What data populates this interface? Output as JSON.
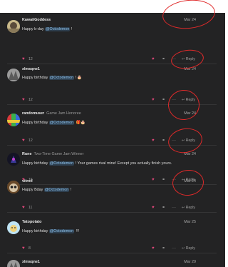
{
  "posts": [
    {
      "username": "KawaiiGoddess",
      "user_title": "",
      "date": "Mar 24",
      "text_before": "Happy b-day ",
      "mention": "@Octodemon",
      "text_after": " !",
      "emoji": "",
      "likes": "12",
      "reply_label": "Reply"
    },
    {
      "username": "xlmsqne1",
      "user_title": "",
      "date": "Mar 24",
      "text_before": "Happy birthday ",
      "mention": "@Octodemon",
      "text_after": " !",
      "emoji": "🎂",
      "likes": "12",
      "reply_label": "Reply"
    },
    {
      "username": "randomuser",
      "user_title": "Game Jam Honoree",
      "date": "Mar 24",
      "text_before": "Happy birthday ",
      "mention": "@Octodemon",
      "text_after": " ",
      "emoji": "🎁🎂",
      "likes": "12",
      "reply_label": "Reply"
    },
    {
      "username": "Rune",
      "user_title": "Two-Time Game Jam Winner",
      "date": "Mar 24",
      "text_before": "Happy birthday ",
      "mention": "@Octodemon",
      "text_after": " ! Your games rival mine! Except you actually finish yours.",
      "emoji": "",
      "likes": "15",
      "reply_label": "Reply"
    },
    {
      "username": "vitroil",
      "user_title": "",
      "date": "Mar 24",
      "text_before": "Happy Bday ",
      "mention": "@Octodemon",
      "text_after": " !",
      "emoji": "",
      "likes": "11",
      "reply_label": "Reply"
    },
    {
      "username": "Tatopotato",
      "user_title": "",
      "date": "Mar 25",
      "text_before": "Happy birthday ",
      "mention": "@Octodemon",
      "text_after": " ",
      "emoji": "!!!",
      "likes": "8",
      "reply_label": "Reply"
    },
    {
      "username": "xlmsqne1",
      "user_title": "",
      "date": "Mar 29",
      "text_before": "",
      "mention": "",
      "text_after": "",
      "emoji": "",
      "likes": "",
      "reply_label": ""
    }
  ]
}
